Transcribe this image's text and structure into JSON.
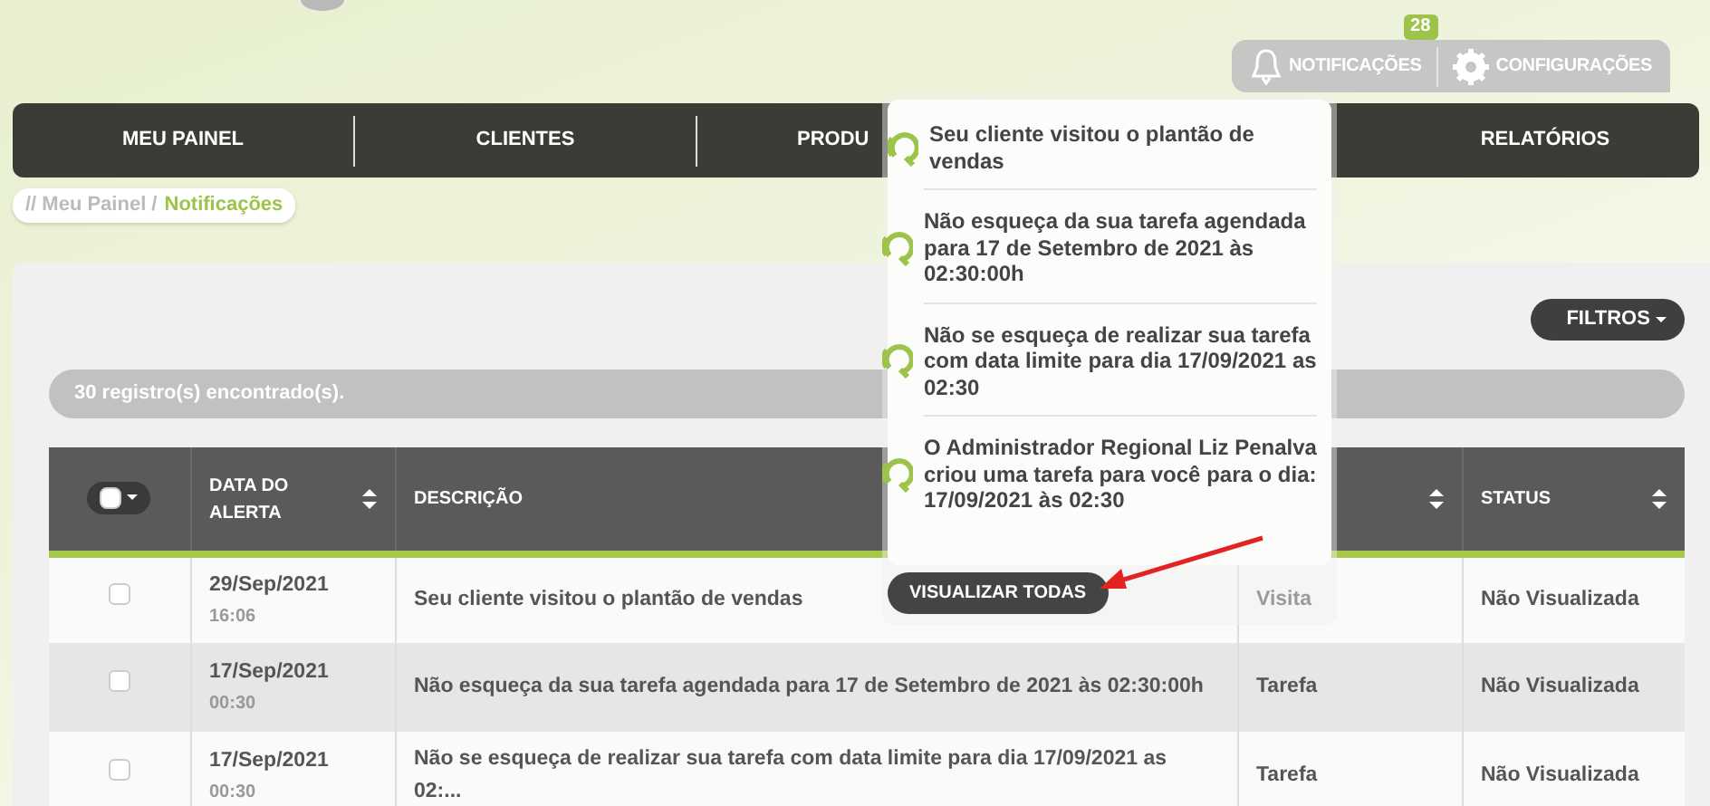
{
  "header": {
    "notifications": {
      "label": "NOTIFICAÇÕES",
      "count": "28"
    },
    "settings": {
      "label": "CONFIGURAÇÕES"
    }
  },
  "nav": {
    "items": [
      {
        "label": "MEU PAINEL"
      },
      {
        "label": "CLIENTES"
      },
      {
        "label": "PRODU"
      },
      {
        "label": "RELATÓRIOS"
      }
    ]
  },
  "breadcrumb": [
    {
      "label": "// Meu Painel /",
      "current": false
    },
    {
      "label": "Notificações",
      "current": true
    }
  ],
  "notifications_dropdown": {
    "items": [
      {
        "text": "Seu cliente visitou o plantão de vendas"
      },
      {
        "text": "Não esqueça da sua tarefa agendada para 17 de Setembro de 2021 às 02:30:00h"
      },
      {
        "text": "Não se esqueça de realizar sua tarefa com data limite para dia 17/09/2021 as 02:30"
      },
      {
        "text": "O Administrador Regional Liz Penalva criou uma tarefa para você para o dia: 17/09/2021 às 02:30"
      }
    ],
    "button": "VISUALIZAR TODAS"
  },
  "filters_button": "FILTROS",
  "records_count": "30 registro(s) encontrado(s).",
  "table": {
    "select_all": {
      "checked": false
    },
    "columns": [
      {
        "label": "DATA DO ALERTA",
        "sortable": true
      },
      {
        "label": "DESCRIÇÃO",
        "sortable": false
      },
      {
        "sortable": true
      },
      {
        "label": "STATUS",
        "sortable": true
      }
    ],
    "rows": [
      {
        "checked": false,
        "date": "29/Sep/2021",
        "time": "16:06",
        "description": "Seu cliente visitou o plantão de vendas",
        "type": "Visita",
        "status": "Não Visualizada"
      },
      {
        "checked": false,
        "date": "17/Sep/2021",
        "time": "00:30",
        "description": "Não esqueça da sua tarefa agendada para 17 de Setembro de 2021 às 02:30:00h",
        "type": "Tarefa",
        "status": "Não Visualizada"
      },
      {
        "checked": false,
        "date": "17/Sep/2021",
        "time": "00:30",
        "description": "Não se esqueça de realizar sua tarefa com data limite para dia 17/09/2021 as 02:...",
        "type": "Tarefa",
        "status": "Não Visualizada"
      }
    ]
  }
}
